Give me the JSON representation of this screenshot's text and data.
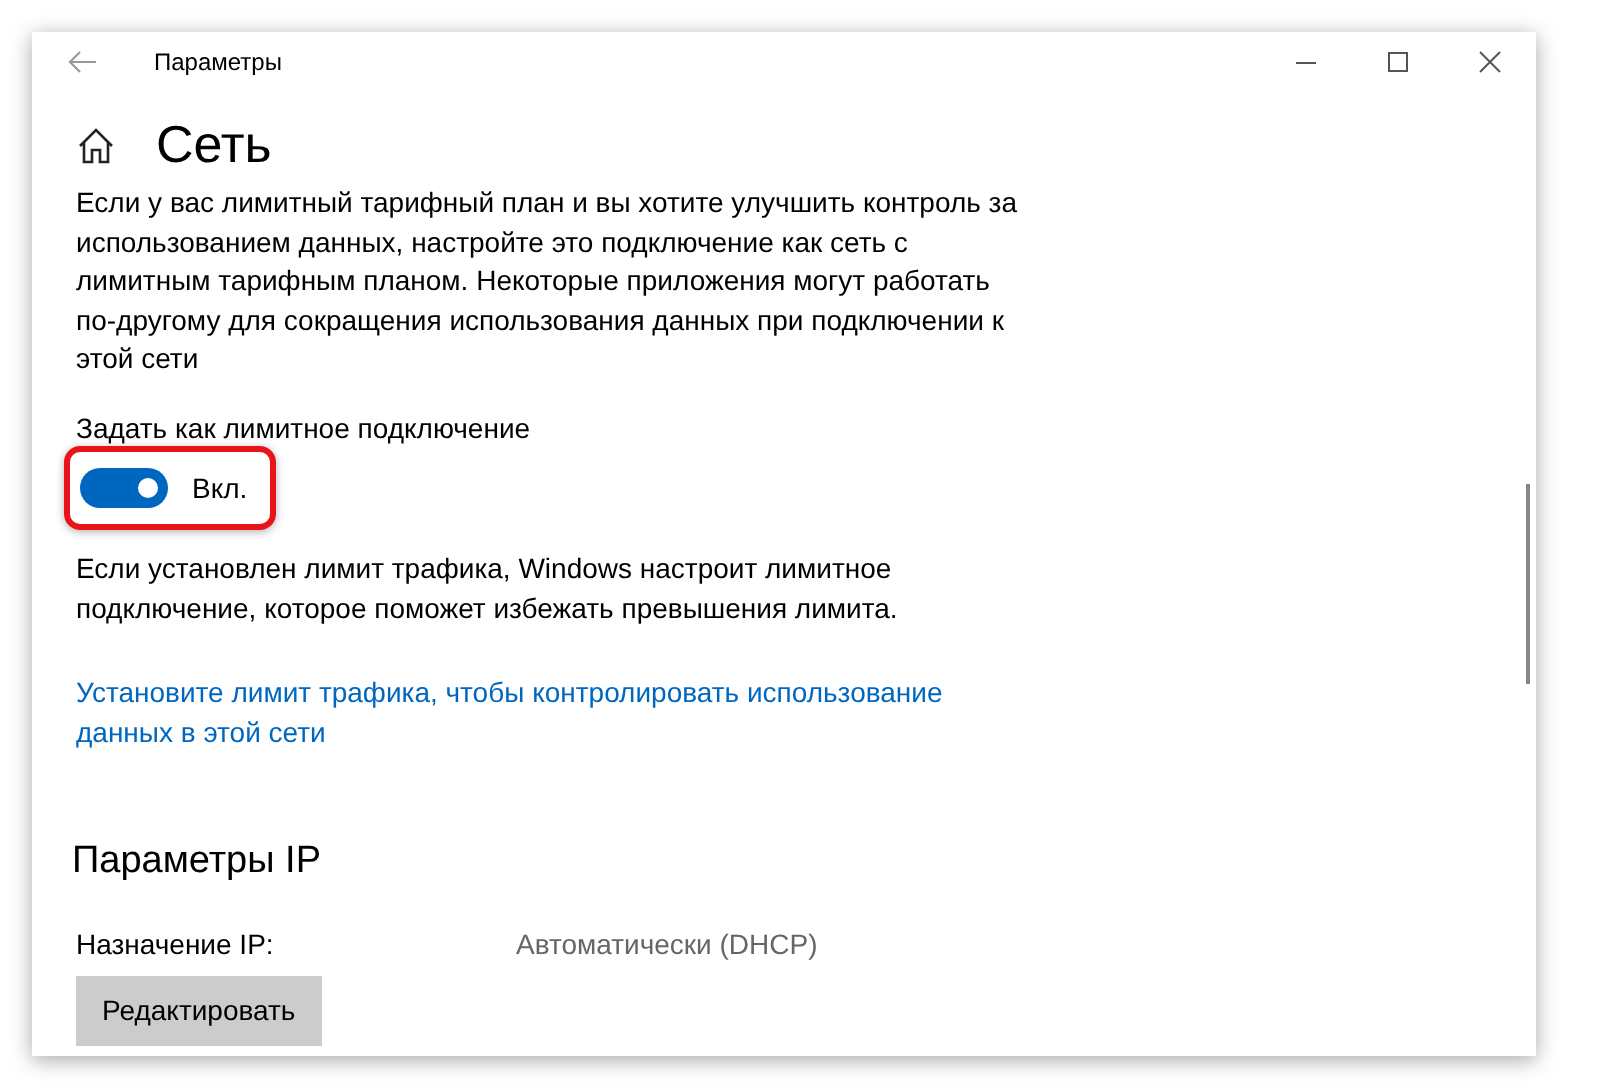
{
  "window": {
    "title": "Параметры"
  },
  "page": {
    "title": "Сеть"
  },
  "description": "Если у вас лимитный тарифный план и вы хотите улучшить контроль за использованием данных, настройте это подключение как сеть с лимитным тарифным планом. Некоторые приложения могут работать по-другому для сокращения использования данных при подключении к этой сети",
  "metered": {
    "label": "Задать как лимитное подключение",
    "on": true,
    "state_text": "Вкл.",
    "highlighted": true
  },
  "note": "Если установлен лимит трафика, Windows настроит лимитное подключение, которое поможет избежать превышения лимита.",
  "link": "Установите лимит трафика, чтобы контролировать использование данных в этой сети",
  "ip": {
    "title": "Параметры IP",
    "label": "Назначение IP:",
    "value": "Автоматически (DHCP)",
    "button": "Редактировать"
  }
}
